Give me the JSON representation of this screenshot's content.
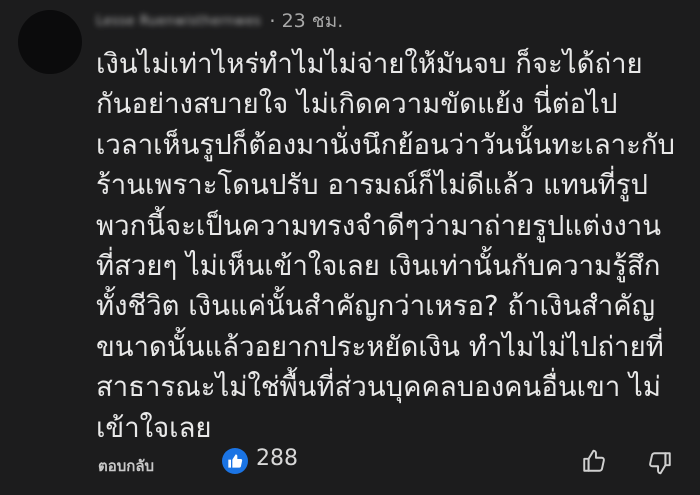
{
  "comment": {
    "author": "Lesse Ruenwisthernwes",
    "time": "23 ชม.",
    "lines": [
      "เงินไม่เท่าไหร่ทำไมไม่จ่ายให้มันจบ ก็จะได้ถ่าย",
      "กันอย่างสบายใจ ไม่เกิดความขัดแย้ง นี่ต่อไป",
      "เวลาเห็นรูปก็ต้องมานั่งนึกย้อนว่าวันนั้นทะเลาะกับ",
      "ร้านเพราะโดนปรับ อารมณ์ก็ไม่ดีแล้ว แทนที่รูป",
      "พวกนี้จะเป็นความทรงจำดีๆว่ามาถ่ายรูปแต่งงาน",
      "ที่สวยๆ ไม่เห็นเข้าใจเลย เงินเท่านั้นกับความรู้สึก",
      "ทั้งชีวิต เงินแค่นั้นสำคัญกว่าเหรอ? ถ้าเงินสำคัญ",
      "ขนาดนั้นแล้วอยากประหยัดเงิน ทำไมไม่ไปถ่ายที่",
      "สาธารณะไม่ใช่พื้นที่ส่วนบุคคลบองคนอื่นเขา ไม่",
      "เข้าใจเลย"
    ]
  },
  "footer": {
    "reply_label": "ตอบกลับ",
    "like_count": "288"
  },
  "icons": {
    "like_badge": "thumbs-up-icon",
    "like_action": "thumbs-up-outline-icon",
    "dislike_action": "thumbs-down-outline-icon"
  },
  "colors": {
    "background": "#1c1c1d",
    "text": "#e8e8e8",
    "secondary_text": "#a8a8a8",
    "like_badge": "#1b74e4"
  }
}
